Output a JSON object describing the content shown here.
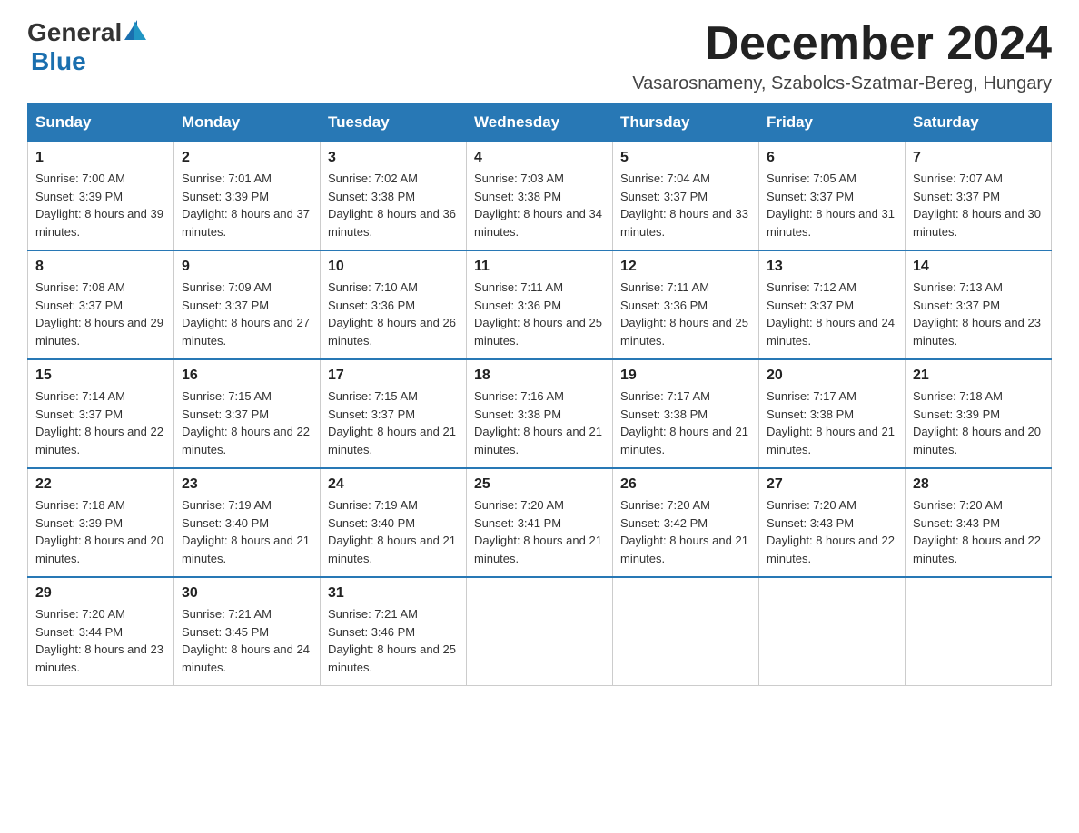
{
  "header": {
    "logo_general": "General",
    "logo_blue": "Blue",
    "title": "December 2024",
    "subtitle": "Vasarosnameny, Szabolcs-Szatmar-Bereg, Hungary"
  },
  "columns": [
    "Sunday",
    "Monday",
    "Tuesday",
    "Wednesday",
    "Thursday",
    "Friday",
    "Saturday"
  ],
  "weeks": [
    [
      {
        "day": "1",
        "sunrise": "7:00 AM",
        "sunset": "3:39 PM",
        "daylight": "8 hours and 39 minutes."
      },
      {
        "day": "2",
        "sunrise": "7:01 AM",
        "sunset": "3:39 PM",
        "daylight": "8 hours and 37 minutes."
      },
      {
        "day": "3",
        "sunrise": "7:02 AM",
        "sunset": "3:38 PM",
        "daylight": "8 hours and 36 minutes."
      },
      {
        "day": "4",
        "sunrise": "7:03 AM",
        "sunset": "3:38 PM",
        "daylight": "8 hours and 34 minutes."
      },
      {
        "day": "5",
        "sunrise": "7:04 AM",
        "sunset": "3:37 PM",
        "daylight": "8 hours and 33 minutes."
      },
      {
        "day": "6",
        "sunrise": "7:05 AM",
        "sunset": "3:37 PM",
        "daylight": "8 hours and 31 minutes."
      },
      {
        "day": "7",
        "sunrise": "7:07 AM",
        "sunset": "3:37 PM",
        "daylight": "8 hours and 30 minutes."
      }
    ],
    [
      {
        "day": "8",
        "sunrise": "7:08 AM",
        "sunset": "3:37 PM",
        "daylight": "8 hours and 29 minutes."
      },
      {
        "day": "9",
        "sunrise": "7:09 AM",
        "sunset": "3:37 PM",
        "daylight": "8 hours and 27 minutes."
      },
      {
        "day": "10",
        "sunrise": "7:10 AM",
        "sunset": "3:36 PM",
        "daylight": "8 hours and 26 minutes."
      },
      {
        "day": "11",
        "sunrise": "7:11 AM",
        "sunset": "3:36 PM",
        "daylight": "8 hours and 25 minutes."
      },
      {
        "day": "12",
        "sunrise": "7:11 AM",
        "sunset": "3:36 PM",
        "daylight": "8 hours and 25 minutes."
      },
      {
        "day": "13",
        "sunrise": "7:12 AM",
        "sunset": "3:37 PM",
        "daylight": "8 hours and 24 minutes."
      },
      {
        "day": "14",
        "sunrise": "7:13 AM",
        "sunset": "3:37 PM",
        "daylight": "8 hours and 23 minutes."
      }
    ],
    [
      {
        "day": "15",
        "sunrise": "7:14 AM",
        "sunset": "3:37 PM",
        "daylight": "8 hours and 22 minutes."
      },
      {
        "day": "16",
        "sunrise": "7:15 AM",
        "sunset": "3:37 PM",
        "daylight": "8 hours and 22 minutes."
      },
      {
        "day": "17",
        "sunrise": "7:15 AM",
        "sunset": "3:37 PM",
        "daylight": "8 hours and 21 minutes."
      },
      {
        "day": "18",
        "sunrise": "7:16 AM",
        "sunset": "3:38 PM",
        "daylight": "8 hours and 21 minutes."
      },
      {
        "day": "19",
        "sunrise": "7:17 AM",
        "sunset": "3:38 PM",
        "daylight": "8 hours and 21 minutes."
      },
      {
        "day": "20",
        "sunrise": "7:17 AM",
        "sunset": "3:38 PM",
        "daylight": "8 hours and 21 minutes."
      },
      {
        "day": "21",
        "sunrise": "7:18 AM",
        "sunset": "3:39 PM",
        "daylight": "8 hours and 20 minutes."
      }
    ],
    [
      {
        "day": "22",
        "sunrise": "7:18 AM",
        "sunset": "3:39 PM",
        "daylight": "8 hours and 20 minutes."
      },
      {
        "day": "23",
        "sunrise": "7:19 AM",
        "sunset": "3:40 PM",
        "daylight": "8 hours and 21 minutes."
      },
      {
        "day": "24",
        "sunrise": "7:19 AM",
        "sunset": "3:40 PM",
        "daylight": "8 hours and 21 minutes."
      },
      {
        "day": "25",
        "sunrise": "7:20 AM",
        "sunset": "3:41 PM",
        "daylight": "8 hours and 21 minutes."
      },
      {
        "day": "26",
        "sunrise": "7:20 AM",
        "sunset": "3:42 PM",
        "daylight": "8 hours and 21 minutes."
      },
      {
        "day": "27",
        "sunrise": "7:20 AM",
        "sunset": "3:43 PM",
        "daylight": "8 hours and 22 minutes."
      },
      {
        "day": "28",
        "sunrise": "7:20 AM",
        "sunset": "3:43 PM",
        "daylight": "8 hours and 22 minutes."
      }
    ],
    [
      {
        "day": "29",
        "sunrise": "7:20 AM",
        "sunset": "3:44 PM",
        "daylight": "8 hours and 23 minutes."
      },
      {
        "day": "30",
        "sunrise": "7:21 AM",
        "sunset": "3:45 PM",
        "daylight": "8 hours and 24 minutes."
      },
      {
        "day": "31",
        "sunrise": "7:21 AM",
        "sunset": "3:46 PM",
        "daylight": "8 hours and 25 minutes."
      },
      null,
      null,
      null,
      null
    ]
  ]
}
